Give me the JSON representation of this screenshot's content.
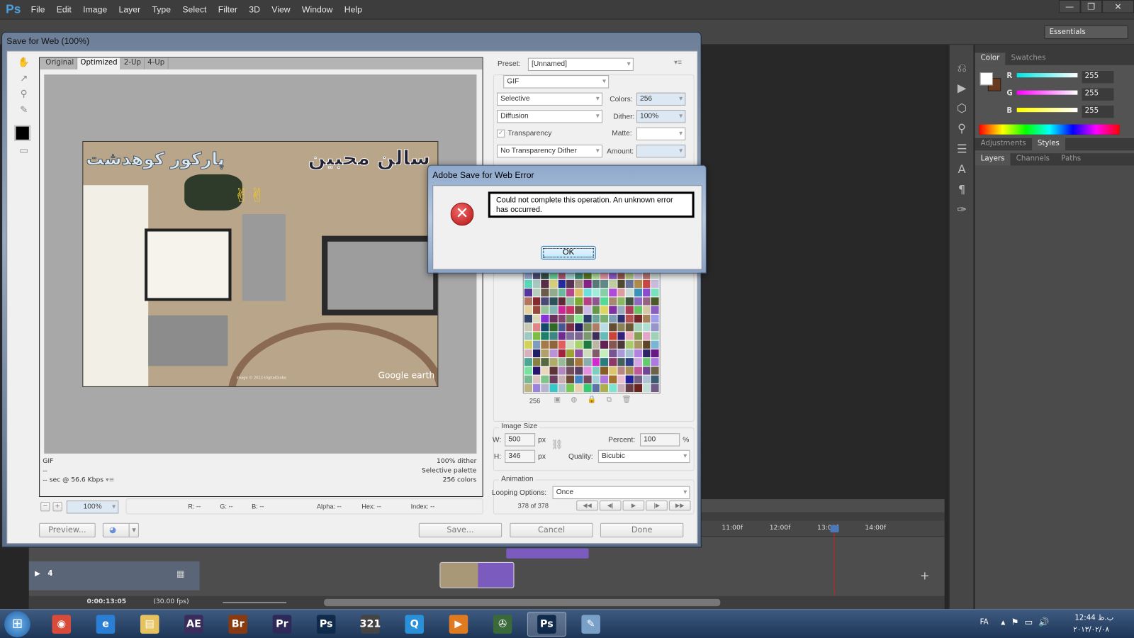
{
  "app": {
    "logo": "Ps",
    "menu": [
      "File",
      "Edit",
      "Image",
      "Layer",
      "Type",
      "Select",
      "Filter",
      "3D",
      "View",
      "Window",
      "Help"
    ],
    "workspace": "Essentials"
  },
  "window_controls": {
    "minimize": "—",
    "restore": "❐",
    "close": "✕"
  },
  "panels": {
    "color_tabs": [
      "Color",
      "Swatches"
    ],
    "channels": [
      {
        "label": "R",
        "value": "255",
        "color": "#00e5e5"
      },
      {
        "label": "G",
        "value": "255",
        "color": "#ff00ff"
      },
      {
        "label": "B",
        "value": "255",
        "color": "#ffff00"
      }
    ],
    "foreground": "#ffffff",
    "background": "#6b3a1e",
    "adj_tabs": [
      "Adjustments",
      "Styles"
    ],
    "layer_tabs": [
      "Layers",
      "Channels",
      "Paths"
    ]
  },
  "save_for_web": {
    "title": "Save for Web (100%)",
    "view_tabs": [
      "Original",
      "Optimized",
      "2-Up",
      "4-Up"
    ],
    "active_tab": "Optimized",
    "image_text": {
      "left": "پارکور کوهدشت",
      "right": "سالن محبین",
      "watermark": "Google earth",
      "small": "Image © 2013 DigitalGlobe"
    },
    "info_left": [
      "GIF",
      "--",
      "-- sec @ 56.6 Kbps"
    ],
    "info_right": [
      "100% dither",
      "Selective palette",
      "256 colors"
    ],
    "zoom": "100%",
    "readouts": [
      "R: --",
      "G: --",
      "B: --",
      "Alpha: --",
      "Hex: --",
      "Index: --"
    ],
    "preview_button": "Preview...",
    "save_button": "Save...",
    "cancel_button": "Cancel",
    "done_button": "Done",
    "preset_label": "Preset:",
    "preset_value": "[Unnamed]",
    "format": "GIF",
    "reduction": "Selective",
    "colors_label": "Colors:",
    "colors_value": "256",
    "dither_algo": "Diffusion",
    "dither_label": "Dither:",
    "dither_value": "100%",
    "transparency_label": "Transparency",
    "transparency_checked": true,
    "matte_label": "Matte:",
    "matte_value": "",
    "trans_dither": "No Transparency Dither",
    "amount_label": "Amount:",
    "amount_value": "",
    "color_count": "256",
    "image_size": {
      "title": "Image Size",
      "w_label": "W:",
      "w": "500",
      "h_label": "H:",
      "h": "346",
      "unit": "px",
      "percent_label": "Percent:",
      "percent": "100",
      "pct": "%",
      "quality_label": "Quality:",
      "quality": "Bicubic"
    },
    "animation": {
      "title": "Animation",
      "looping_label": "Looping Options:",
      "looping": "Once",
      "frame": "378 of 378"
    }
  },
  "error_dialog": {
    "title": "Adobe Save for Web Error",
    "message": "Could not complete this operation. An unknown error has occurred.",
    "ok": "OK"
  },
  "timeline": {
    "ticks": [
      "11:00f",
      "12:00f",
      "13:00f",
      "14:00f"
    ],
    "track": "4",
    "timecode": "0:00:13:05",
    "fps": "(30.00 fps)"
  },
  "taskbar": {
    "apps": [
      {
        "name": "chrome",
        "label": "◉",
        "color": "#d84b3a"
      },
      {
        "name": "ie",
        "label": "e",
        "color": "#2a7fd4"
      },
      {
        "name": "explorer",
        "label": "▤",
        "color": "#e7c260"
      },
      {
        "name": "after-effects",
        "label": "AE",
        "color": "#3a2d5c"
      },
      {
        "name": "bridge",
        "label": "Br",
        "color": "#8a3a10"
      },
      {
        "name": "premiere",
        "label": "Pr",
        "color": "#2d2a5a"
      },
      {
        "name": "photoshop-pinned",
        "label": "Ps",
        "color": "#0f2a4a"
      },
      {
        "name": "media-player-321",
        "label": "321",
        "color": "#444"
      },
      {
        "name": "quicktime",
        "label": "Q",
        "color": "#2a90d8"
      },
      {
        "name": "media-player",
        "label": "▶",
        "color": "#e07a20"
      },
      {
        "name": "media-center",
        "label": "✇",
        "color": "#3a6a3a"
      },
      {
        "name": "photoshop",
        "label": "Ps",
        "color": "#0f2a4a"
      },
      {
        "name": "paint",
        "label": "✎",
        "color": "#7aa0c8"
      }
    ],
    "lang": "FA",
    "time": "ب.ظ 12:44",
    "date": "۲۰۱۳/۰۲/۰۸"
  }
}
